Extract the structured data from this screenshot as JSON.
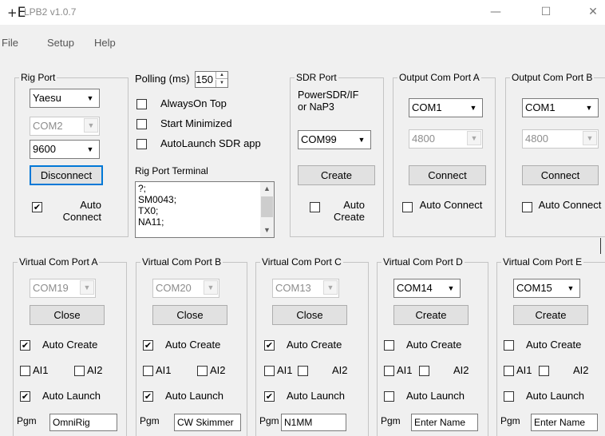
{
  "window": {
    "title": "LPB2 v1.0.7",
    "icon": "lpb2-app-icon",
    "minimize": "—",
    "maximize": "☐",
    "close": "✕"
  },
  "menu": [
    "File",
    "Setup",
    "Help"
  ],
  "rig": {
    "title": "Rig Port",
    "make": "Yaesu",
    "com": "COM2",
    "baud": "9600",
    "button": "Disconnect",
    "auto_label": "Auto Connect",
    "auto_checked": true
  },
  "polling": {
    "label": "Polling (ms)",
    "value": "150"
  },
  "options": [
    {
      "label": "AlwaysOn Top",
      "checked": false
    },
    {
      "label": "Start Minimized",
      "checked": false
    },
    {
      "label": "AutoLaunch SDR app",
      "checked": false
    }
  ],
  "terminal": {
    "label": "Rig Port Terminal",
    "lines": [
      "?;",
      "SM0043;",
      "TX0;",
      "NA11;"
    ]
  },
  "sdr": {
    "title": "SDR Port",
    "text": "PowerSDR/IF or NaP3",
    "com": "COM99",
    "button": "Create",
    "auto_label": "Auto Create",
    "auto_checked": false
  },
  "outputs": [
    {
      "title": "Output Com Port A",
      "com": "COM1",
      "baud": "4800",
      "button": "Connect",
      "auto_label": "Auto Connect",
      "auto_checked": false
    },
    {
      "title": "Output Com Port B",
      "com": "COM1",
      "baud": "4800",
      "button": "Connect",
      "auto_label": "Auto Connect",
      "auto_checked": false
    }
  ],
  "virtual": [
    {
      "title": "Virtual Com Port A",
      "com": "COM19",
      "com_enabled": false,
      "button": "Close",
      "auto_create": true,
      "ai1": false,
      "ai2": false,
      "auto_launch": true,
      "pgm": "OmniRig"
    },
    {
      "title": "Virtual Com Port B",
      "com": "COM20",
      "com_enabled": false,
      "button": "Close",
      "auto_create": true,
      "ai1": false,
      "ai2": false,
      "auto_launch": true,
      "pgm": "CW Skimmer"
    },
    {
      "title": "Virtual Com Port C",
      "com": "COM13",
      "com_enabled": false,
      "button": "Close",
      "auto_create": true,
      "ai1": false,
      "ai2": false,
      "auto_launch": true,
      "pgm": "N1MM"
    },
    {
      "title": "Virtual Com Port D",
      "com": "COM14",
      "com_enabled": true,
      "button": "Create",
      "auto_create": false,
      "ai1": false,
      "ai2": false,
      "auto_launch": false,
      "pgm": "Enter Name"
    },
    {
      "title": "Virtual Com Port E",
      "com": "COM15",
      "com_enabled": true,
      "button": "Create",
      "auto_create": false,
      "ai1": false,
      "ai2": false,
      "auto_launch": false,
      "pgm": "Enter Name"
    }
  ],
  "virtual_labels": {
    "auto_create": "Auto Create",
    "ai1": "AI1",
    "ai2": "AI2",
    "auto_launch": "Auto Launch",
    "pgm": "Pgm"
  },
  "check_mark": "✔",
  "dropdown_icon": "▼",
  "up_icon": "▲",
  "colors": {
    "focus_border": "#0078d7",
    "title_text": "#8a8a8a"
  }
}
